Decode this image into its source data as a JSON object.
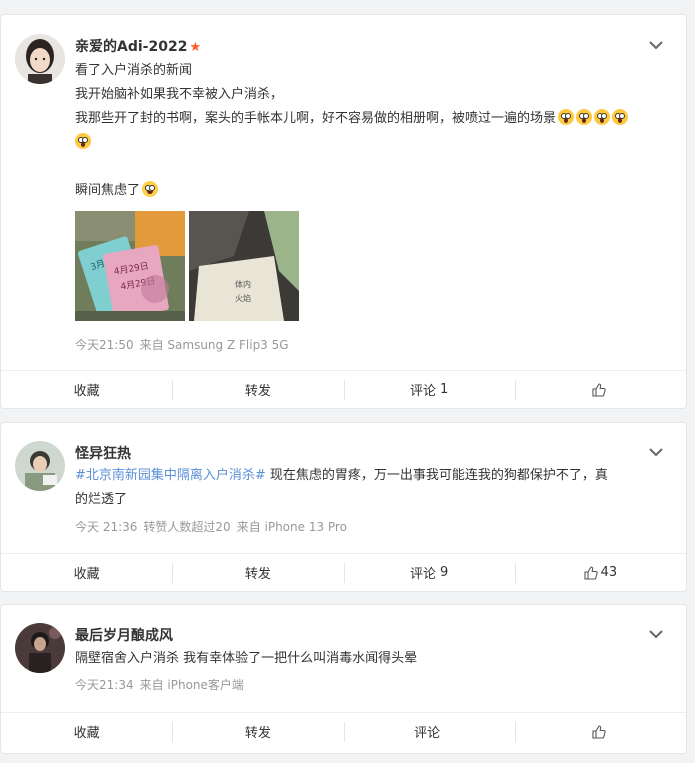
{
  "posts": [
    {
      "username": "亲爱的Adi-2022",
      "lines": [
        "看了入户消杀的新闻",
        "我开始脑补如果我不幸被入户消杀，",
        "我那些开了封的书啊，案头的手帐本儿啊，好不容易做的相册啊，被喷过一遍的场景",
        "",
        "瞬间焦虑了"
      ],
      "emojis": {
        "line3": [
          "scream-emoji",
          "scream-emoji",
          "scream-emoji",
          "scream-emoji",
          "scream-emoji"
        ],
        "line5": [
          "crying-emoji"
        ]
      },
      "photo_text": {
        "ticket_date_1": "4月29日",
        "ticket_date_2": "4月29日",
        "ticket_date_3": "3月19日",
        "book_text_1": "体内",
        "book_text_2": "火焰"
      },
      "meta": {
        "time": "今天21:50",
        "source": "来自 Samsung Z Flip3 5G"
      },
      "actions": {
        "favorite": "收藏",
        "repost": "转发",
        "comment": "评论",
        "comment_count": "1",
        "like_count": ""
      }
    },
    {
      "username": "怪异狂热",
      "hashtag": "#北京南新园集中隔离入户消杀#",
      "text_after_hashtag": " 现在焦虑的胃疼，万一出事我可能连我的狗都保护不了，真",
      "text_line2": "的烂透了",
      "meta": {
        "time": "今天 21:36",
        "extra": "转赞人数超过20",
        "source": "来自 iPhone 13 Pro"
      },
      "actions": {
        "favorite": "收藏",
        "repost": "转发",
        "comment": "评论",
        "comment_count": "9",
        "like_count": "43"
      }
    },
    {
      "username": "最后岁月酿成风",
      "text": "隔壁宿舍入户消杀 我有幸体验了一把什么叫消毒水闻得头晕",
      "meta": {
        "time": "今天21:34",
        "source": "来自 iPhone客户端"
      },
      "actions": {
        "favorite": "收藏",
        "repost": "转发",
        "comment": "评论",
        "comment_count": "",
        "like_count": ""
      }
    }
  ],
  "colors": {
    "hashtag": "#5b8fd6",
    "vip_star": "#ff5a1f",
    "meta": "#999999",
    "background": "#f2f3f5"
  },
  "icons": {
    "vip": "star-icon",
    "menu": "chevron-down-icon",
    "like": "thumbs-up-icon"
  }
}
